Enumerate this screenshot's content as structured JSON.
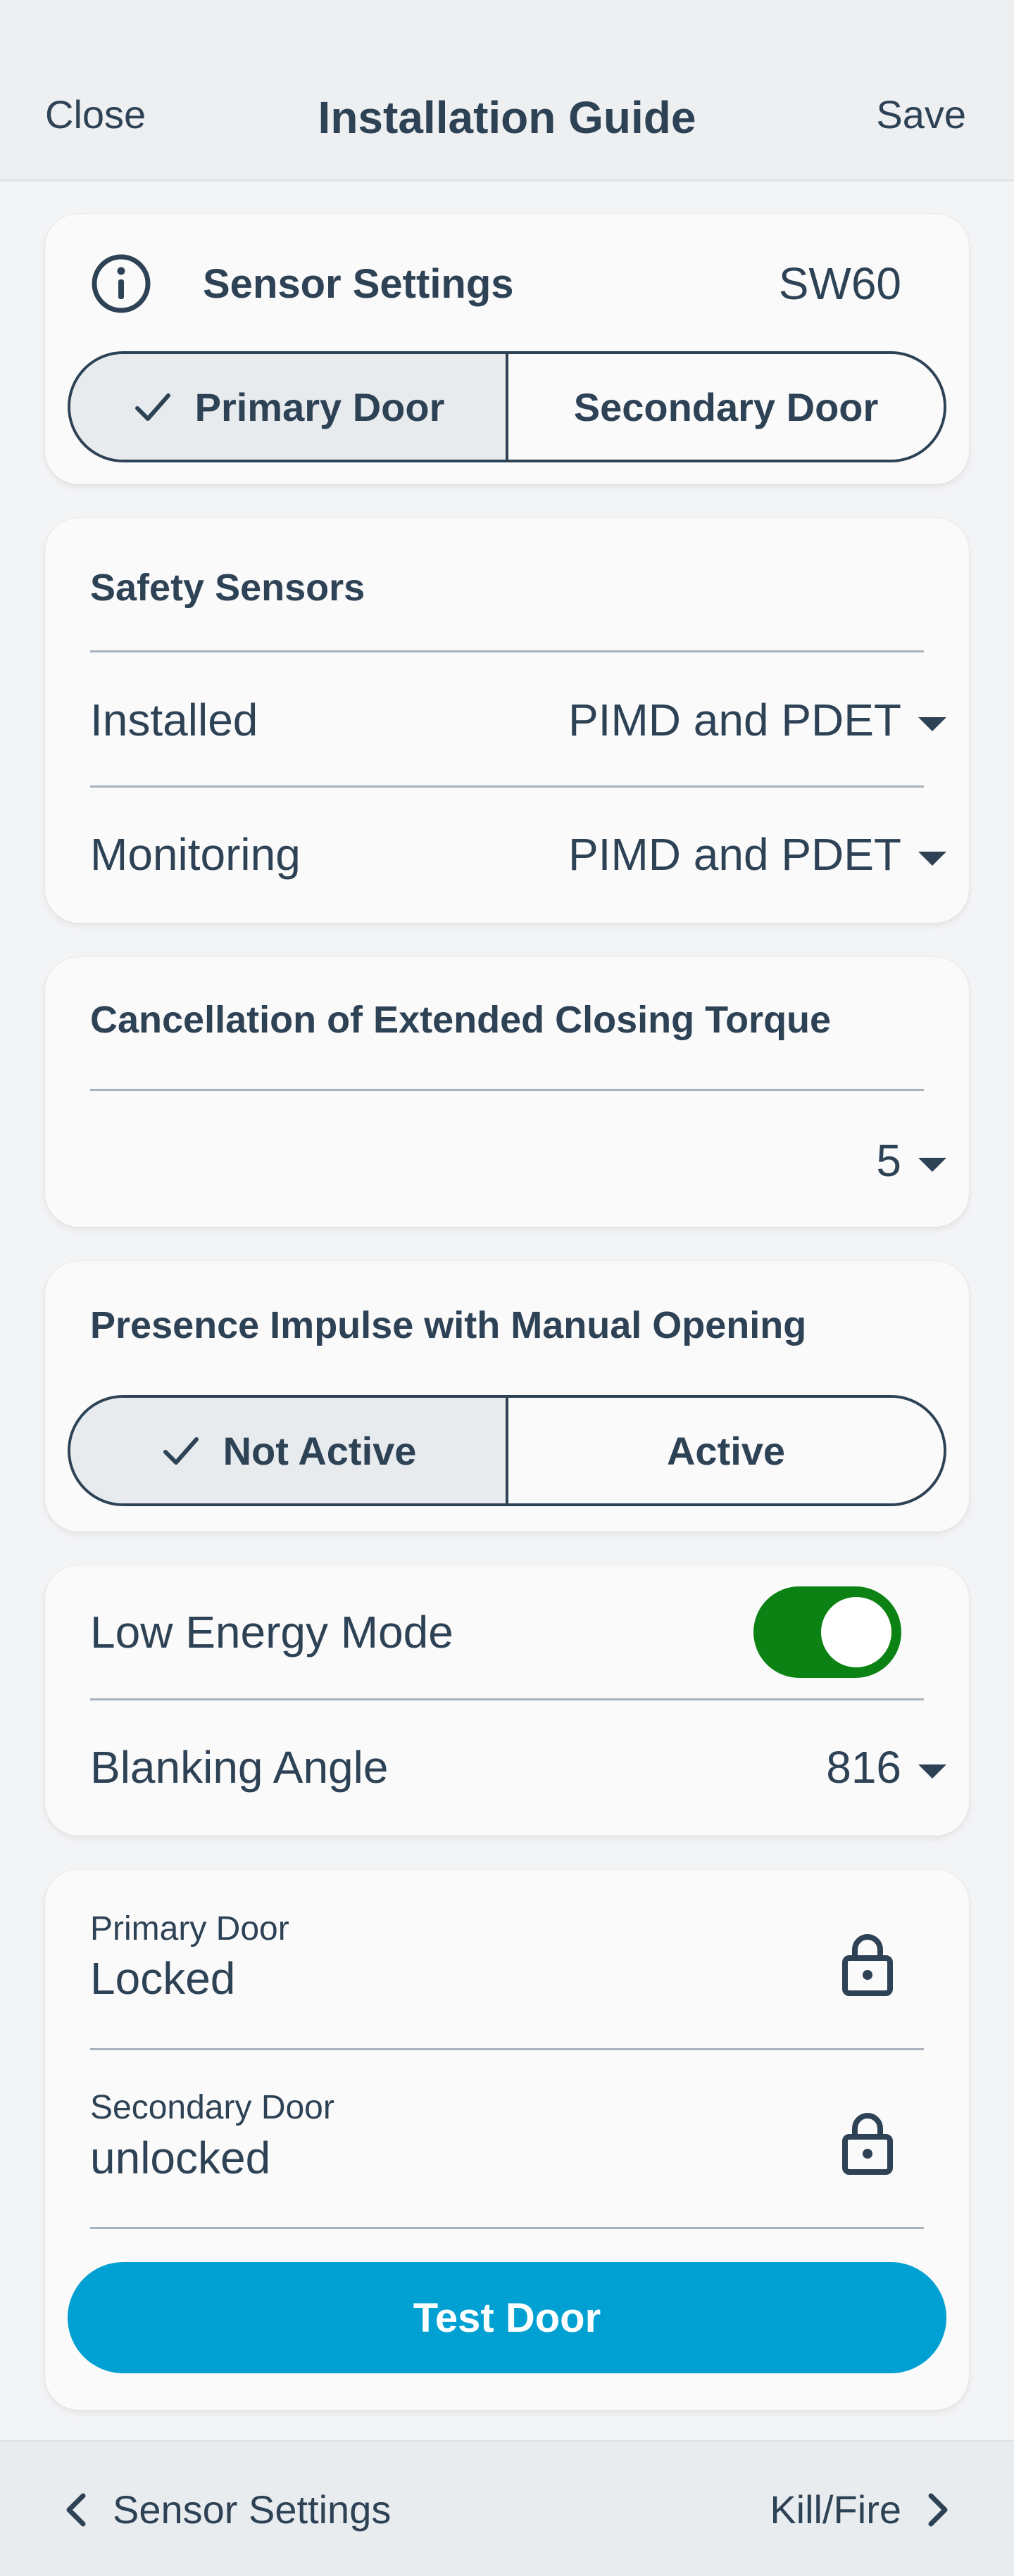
{
  "header": {
    "close_label": "Close",
    "title": "Installation Guide",
    "save_label": "Save"
  },
  "sensor_settings": {
    "icon": "info-icon",
    "title": "Sensor Settings",
    "model": "SW60",
    "door_options": [
      {
        "label": "Primary Door",
        "selected": true
      },
      {
        "label": "Secondary Door",
        "selected": false
      }
    ]
  },
  "safety_sensors": {
    "title": "Safety Sensors",
    "rows": [
      {
        "label": "Installed",
        "value": "PIMD and PDET"
      },
      {
        "label": "Monitoring",
        "value": "PIMD and PDET"
      }
    ]
  },
  "closing_torque": {
    "title": "Cancellation of Extended Closing Torque",
    "value": "5"
  },
  "presence_impulse": {
    "title": "Presence Impulse with Manual Opening",
    "options": [
      {
        "label": "Not Active",
        "selected": true
      },
      {
        "label": "Active",
        "selected": false
      }
    ]
  },
  "low_energy": {
    "label": "Low Energy Mode",
    "enabled": true,
    "toggle_color": "#0b8213",
    "blanking_label": "Blanking Angle",
    "blanking_value": "816"
  },
  "doors": {
    "items": [
      {
        "label": "Primary Door",
        "status": "Locked",
        "icon": "lock-icon"
      },
      {
        "label": "Secondary Door",
        "status": "unlocked",
        "icon": "lock-icon"
      }
    ],
    "test_button": "Test Door",
    "test_button_color": "#00a1d2"
  },
  "footer": {
    "back_label": "Sensor Settings",
    "next_label": "Kill/Fire"
  }
}
